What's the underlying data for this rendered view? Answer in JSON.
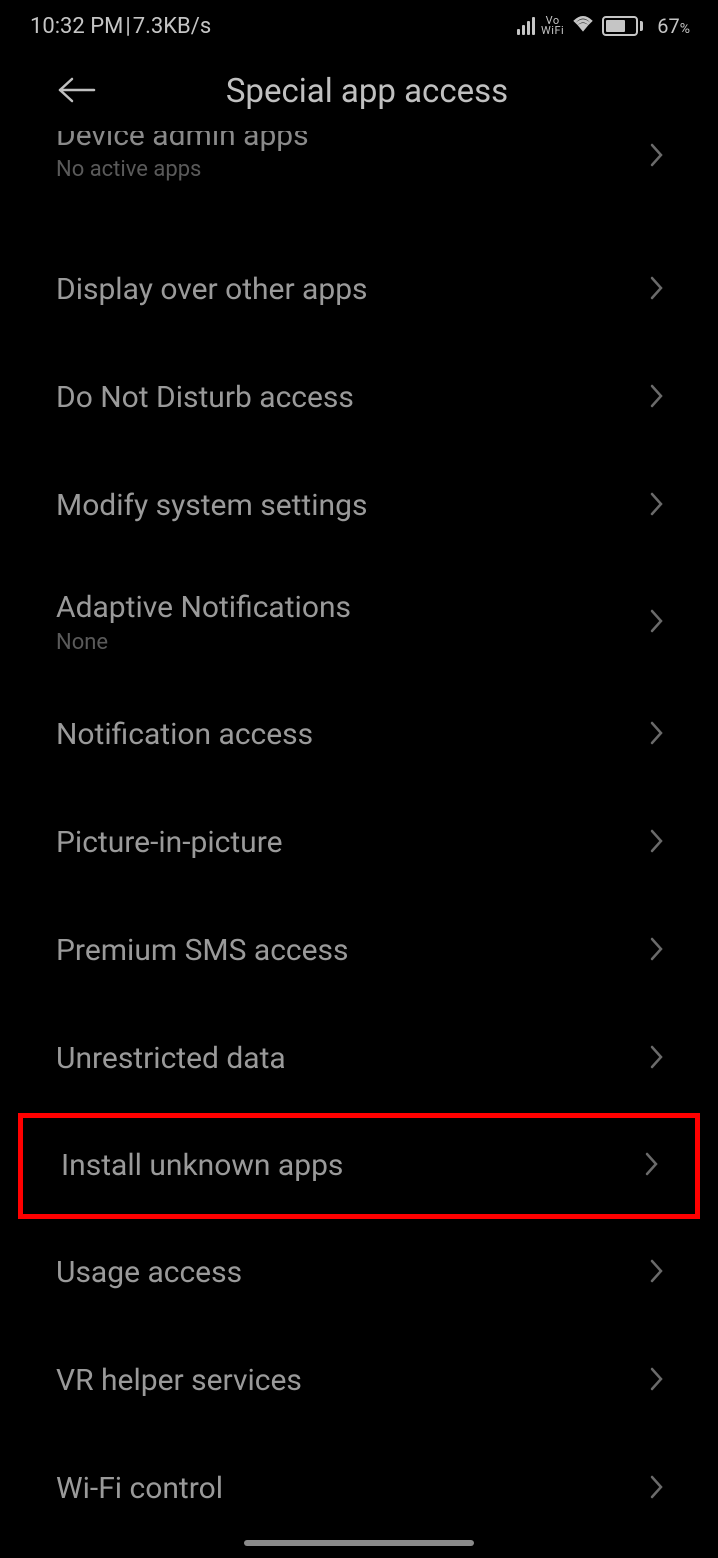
{
  "status": {
    "time": "10:32 PM",
    "separator": " | ",
    "netspeed": "7.3KB/s",
    "vowifi_top": "Vo",
    "vowifi_bottom": "WiFi",
    "battery_percent": "67",
    "percent_sign": "%"
  },
  "header": {
    "title": "Special app access"
  },
  "partial": {
    "title": "Device admin apps",
    "subtitle": "No active apps"
  },
  "items": [
    {
      "title": "Display over other apps",
      "subtitle": ""
    },
    {
      "title": "Do Not Disturb access",
      "subtitle": ""
    },
    {
      "title": "Modify system settings",
      "subtitle": ""
    },
    {
      "title": "Adaptive Notifications",
      "subtitle": "None"
    },
    {
      "title": "Notification access",
      "subtitle": ""
    },
    {
      "title": "Picture-in-picture",
      "subtitle": ""
    },
    {
      "title": "Premium SMS access",
      "subtitle": ""
    },
    {
      "title": "Unrestricted data",
      "subtitle": ""
    },
    {
      "title": "Install unknown apps",
      "subtitle": "",
      "highlight": true
    },
    {
      "title": "Usage access",
      "subtitle": ""
    },
    {
      "title": "VR helper services",
      "subtitle": ""
    },
    {
      "title": "Wi-Fi control",
      "subtitle": ""
    }
  ]
}
